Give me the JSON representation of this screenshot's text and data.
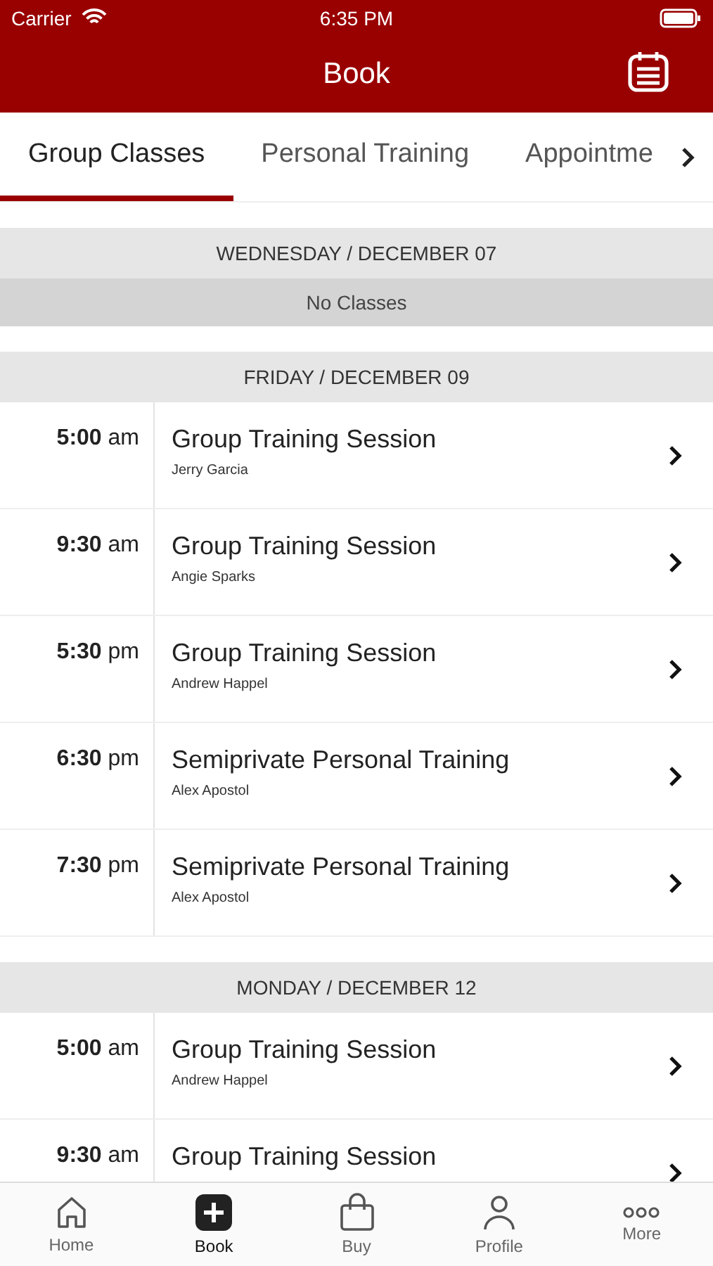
{
  "status_bar": {
    "carrier": "Carrier",
    "time": "6:35 PM"
  },
  "header": {
    "title": "Book"
  },
  "tabs": [
    {
      "label": "Group Classes",
      "selected": true
    },
    {
      "label": "Personal Training",
      "selected": false
    },
    {
      "label": "Appointme",
      "selected": false
    }
  ],
  "days": [
    {
      "heading": "WEDNESDAY / DECEMBER 07",
      "empty_text": "No Classes"
    },
    {
      "heading": "FRIDAY / DECEMBER 09",
      "sessions": [
        {
          "time": "**5:00** am",
          "title": "Group Training Session",
          "instructor": "Jerry Garcia"
        },
        {
          "time": "**9:30** am",
          "title": "Group Training Session",
          "instructor": "Angie Sparks"
        },
        {
          "time": "**5:30** pm",
          "title": "Group Training Session",
          "instructor": "Andrew Happel"
        },
        {
          "time": "**6:30** pm",
          "title": "Semiprivate Personal Training",
          "instructor": "Alex Apostol"
        },
        {
          "time": "**7:30** pm",
          "title": "Semiprivate Personal Training",
          "instructor": "Alex Apostol"
        }
      ]
    },
    {
      "heading": "MONDAY / DECEMBER 12",
      "sessions": [
        {
          "time": "**5:00** am",
          "title": "Group Training Session",
          "instructor": "Andrew Happel"
        },
        {
          "time": "**9:30** am",
          "title": "Group Training Session"
        }
      ]
    }
  ],
  "tab_bar": [
    {
      "kind": "home",
      "label": "Home",
      "selected": false
    },
    {
      "kind": "book",
      "label": "Book",
      "selected": true
    },
    {
      "kind": "buy",
      "label": "Buy",
      "selected": false
    },
    {
      "kind": "profile",
      "label": "Profile",
      "selected": false
    },
    {
      "kind": "more",
      "label": "More",
      "selected": false
    }
  ]
}
